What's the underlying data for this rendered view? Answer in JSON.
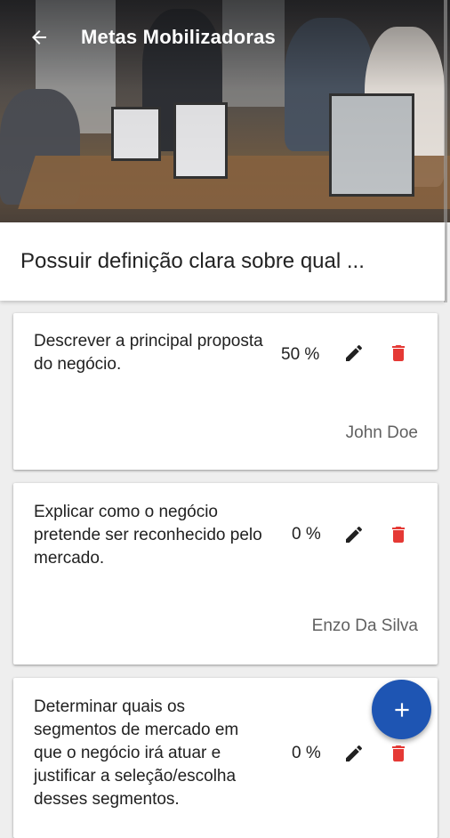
{
  "header": {
    "title": "Metas Mobilizadoras",
    "back_icon": "arrow-back-icon"
  },
  "goal": {
    "title": "Possuir definição clara sobre qual ..."
  },
  "tasks": [
    {
      "description": "Descrever a principal proposta do negócio.",
      "percent": "50 %",
      "owner": "John Doe"
    },
    {
      "description": "Explicar como o negócio pretende ser reconhecido pelo mercado.",
      "percent": "0 %",
      "owner": "Enzo Da Silva"
    },
    {
      "description": "Determinar quais os segmentos de mercado em que o negócio irá atuar e justificar a seleção/escolha desses segmentos.",
      "percent": "0 %",
      "owner": ""
    }
  ],
  "colors": {
    "accent": "#1e55b3",
    "delete": "#e53935",
    "edit": "#212121"
  },
  "fab": {
    "icon": "plus-icon"
  }
}
